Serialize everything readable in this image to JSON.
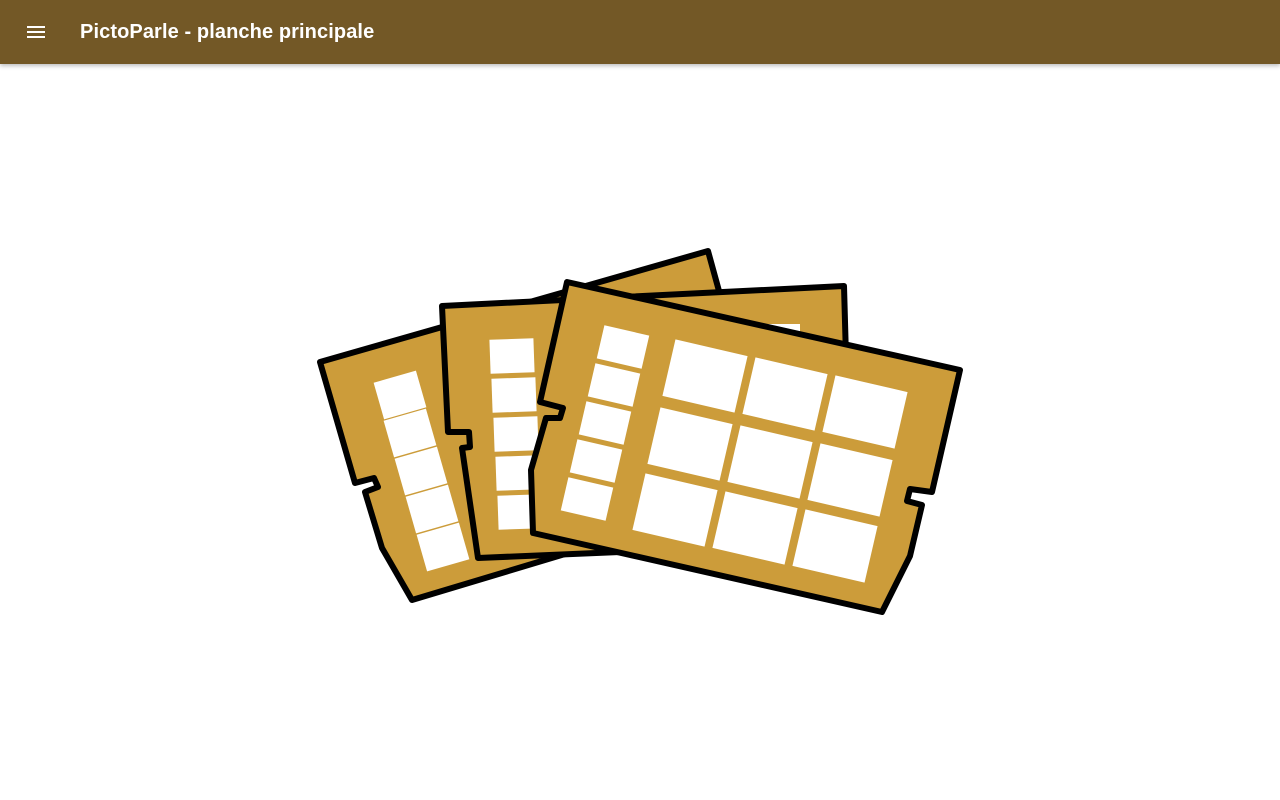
{
  "header": {
    "title": "PictoParle - planche principale",
    "menu_icon": "menu-icon"
  },
  "illustration": {
    "icon": "communication-boards-icon",
    "board_color": "#cc9c3a",
    "outline_color": "#000000"
  },
  "colors": {
    "appbar": "#735826",
    "title_text": "#ffffff",
    "background": "#ffffff"
  }
}
